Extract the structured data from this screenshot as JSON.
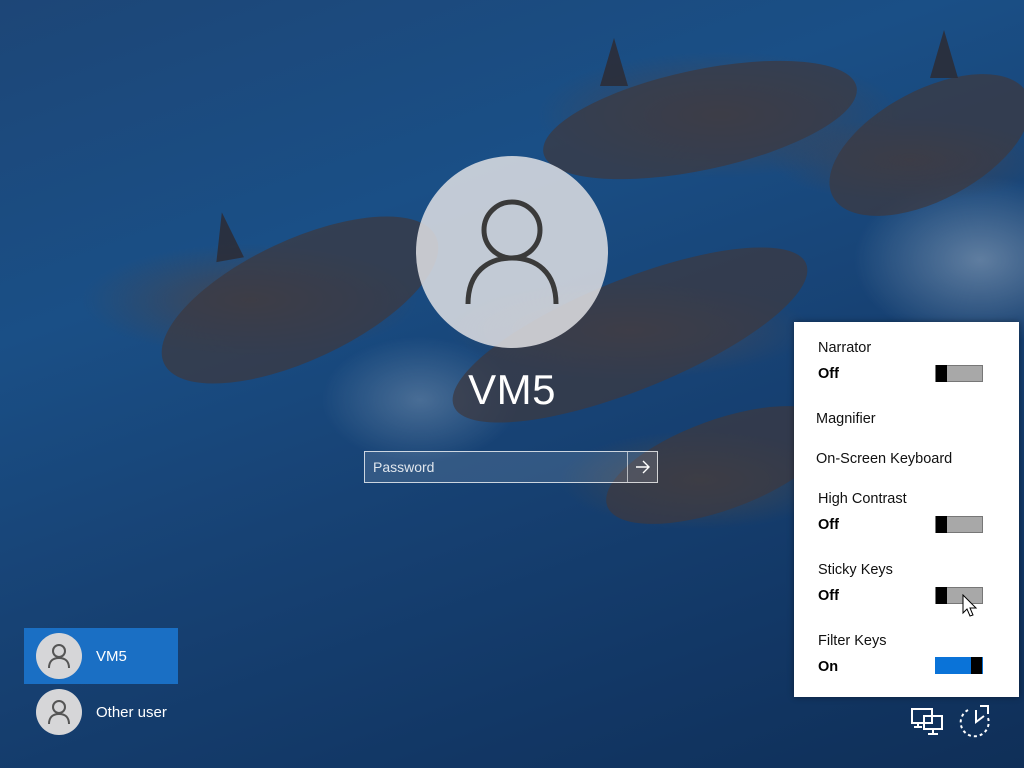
{
  "login": {
    "username": "VM5",
    "password_placeholder": "Password"
  },
  "users": [
    {
      "name": "VM5",
      "selected": true
    },
    {
      "name": "Other user",
      "selected": false
    }
  ],
  "ease_of_access": {
    "narrator": {
      "title": "Narrator",
      "state": "Off"
    },
    "magnifier": {
      "title": "Magnifier"
    },
    "onscreen_keyboard": {
      "title": "On-Screen Keyboard"
    },
    "high_contrast": {
      "title": "High Contrast",
      "state": "Off"
    },
    "sticky_keys": {
      "title": "Sticky Keys",
      "state": "Off"
    },
    "filter_keys": {
      "title": "Filter Keys",
      "state": "On"
    },
    "toggle_on_color": "#0a73d8"
  },
  "taskbar_icons": [
    "network-icon",
    "ease-of-access-icon"
  ]
}
